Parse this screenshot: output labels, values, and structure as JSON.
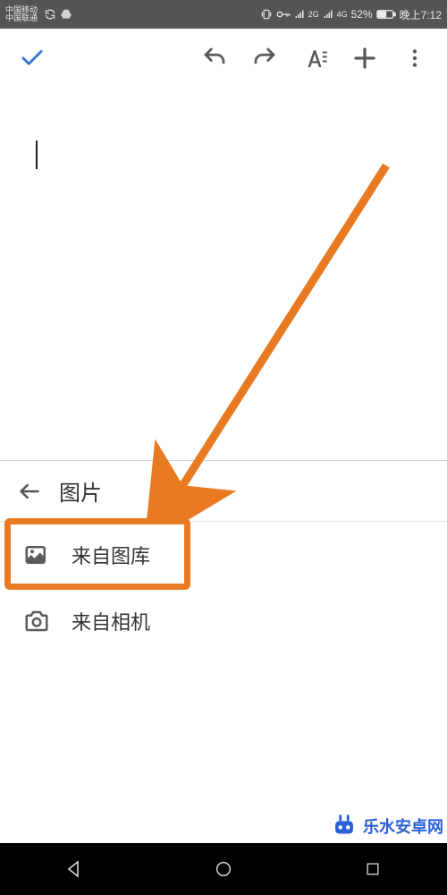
{
  "status_bar": {
    "carrier1": "中国移动",
    "carrier2": "中国联通",
    "net1": "2G",
    "net2": "4G",
    "battery_pct": "52%",
    "time": "晚上7:12"
  },
  "toolbar": {
    "icons": {
      "done": "done-check-icon",
      "undo": "undo-icon",
      "redo": "redo-icon",
      "format": "text-format-icon",
      "insert": "plus-icon",
      "more": "more-vert-icon"
    }
  },
  "sheet": {
    "title": "图片",
    "items": [
      {
        "icon": "gallery-icon",
        "label": "来自图库"
      },
      {
        "icon": "camera-icon",
        "label": "来自相机"
      }
    ]
  },
  "annotation": {
    "color": "#e87a22"
  },
  "watermark": {
    "text": "乐水安卓网"
  }
}
